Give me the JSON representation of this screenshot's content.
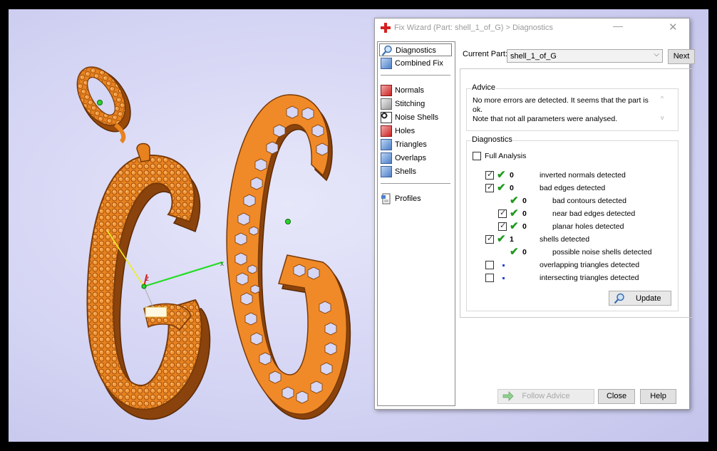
{
  "window": {
    "title": "Fix Wizard (Part: shell_1_of_G) > Diagnostics",
    "minimize_glyph": "—",
    "close_glyph": "✕"
  },
  "sidebar": {
    "items": [
      {
        "label": "Diagnostics",
        "icon": "magnifier-icon",
        "active": true
      },
      {
        "label": "Combined Fix",
        "icon": "cube-icon"
      },
      {
        "label": "Normals",
        "icon": "cube-icon"
      },
      {
        "label": "Stitching",
        "icon": "cube-icon"
      },
      {
        "label": "Noise Shells",
        "icon": "noise-shells-icon"
      },
      {
        "label": "Holes",
        "icon": "holes-icon"
      },
      {
        "label": "Triangles",
        "icon": "cube-icon"
      },
      {
        "label": "Overlaps",
        "icon": "cube-icon"
      },
      {
        "label": "Shells",
        "icon": "cube-icon"
      },
      {
        "label": "Profiles",
        "icon": "document-icon"
      }
    ]
  },
  "part": {
    "label": "Current Part:",
    "value": "shell_1_of_G",
    "next_label": "Next"
  },
  "advice": {
    "title": "Advice",
    "line1": "No more errors are detected. It seems that the part is ok.",
    "line2": "Note that not all parameters were analysed.",
    "scroll_up": "^",
    "scroll_down": "v"
  },
  "diagnostics": {
    "title": "Diagnostics",
    "full_analysis_label": "Full Analysis",
    "full_analysis_checked": false,
    "rows": [
      {
        "label": "inverted normals detected",
        "count": "0",
        "checked": true,
        "ok": true
      },
      {
        "label": "bad edges detected",
        "count": "0",
        "checked": true,
        "ok": true
      },
      {
        "label": "bad contours detected",
        "count": "0",
        "checked": null,
        "ok": true
      },
      {
        "label": "near bad edges detected",
        "count": "0",
        "checked": true,
        "ok": true
      },
      {
        "label": "planar holes detected",
        "count": "0",
        "checked": true,
        "ok": true
      },
      {
        "label": "shells detected",
        "count": "1",
        "checked": true,
        "ok": true
      },
      {
        "label": "possible noise shells detected",
        "count": "0",
        "checked": null,
        "ok": true
      },
      {
        "label": "overlapping triangles detected",
        "count": "",
        "checked": false,
        "ok": false
      },
      {
        "label": "intersecting triangles detected",
        "count": "",
        "checked": false,
        "ok": false
      }
    ],
    "check_glyph": "✔",
    "box_glyph": "✓",
    "update_label": "Update"
  },
  "footer": {
    "follow_label": "Follow Advice",
    "close_label": "Close",
    "help_label": "Help"
  },
  "viewport": {
    "axis_x": "x",
    "axis_z": "z",
    "colors": {
      "model": "#f08a28",
      "model_dark": "#a24d0a",
      "axis_x": "#22dd22",
      "axis_y": "#eeee22",
      "axis_z": "#dd2222",
      "background": "#d6d6f5"
    }
  }
}
